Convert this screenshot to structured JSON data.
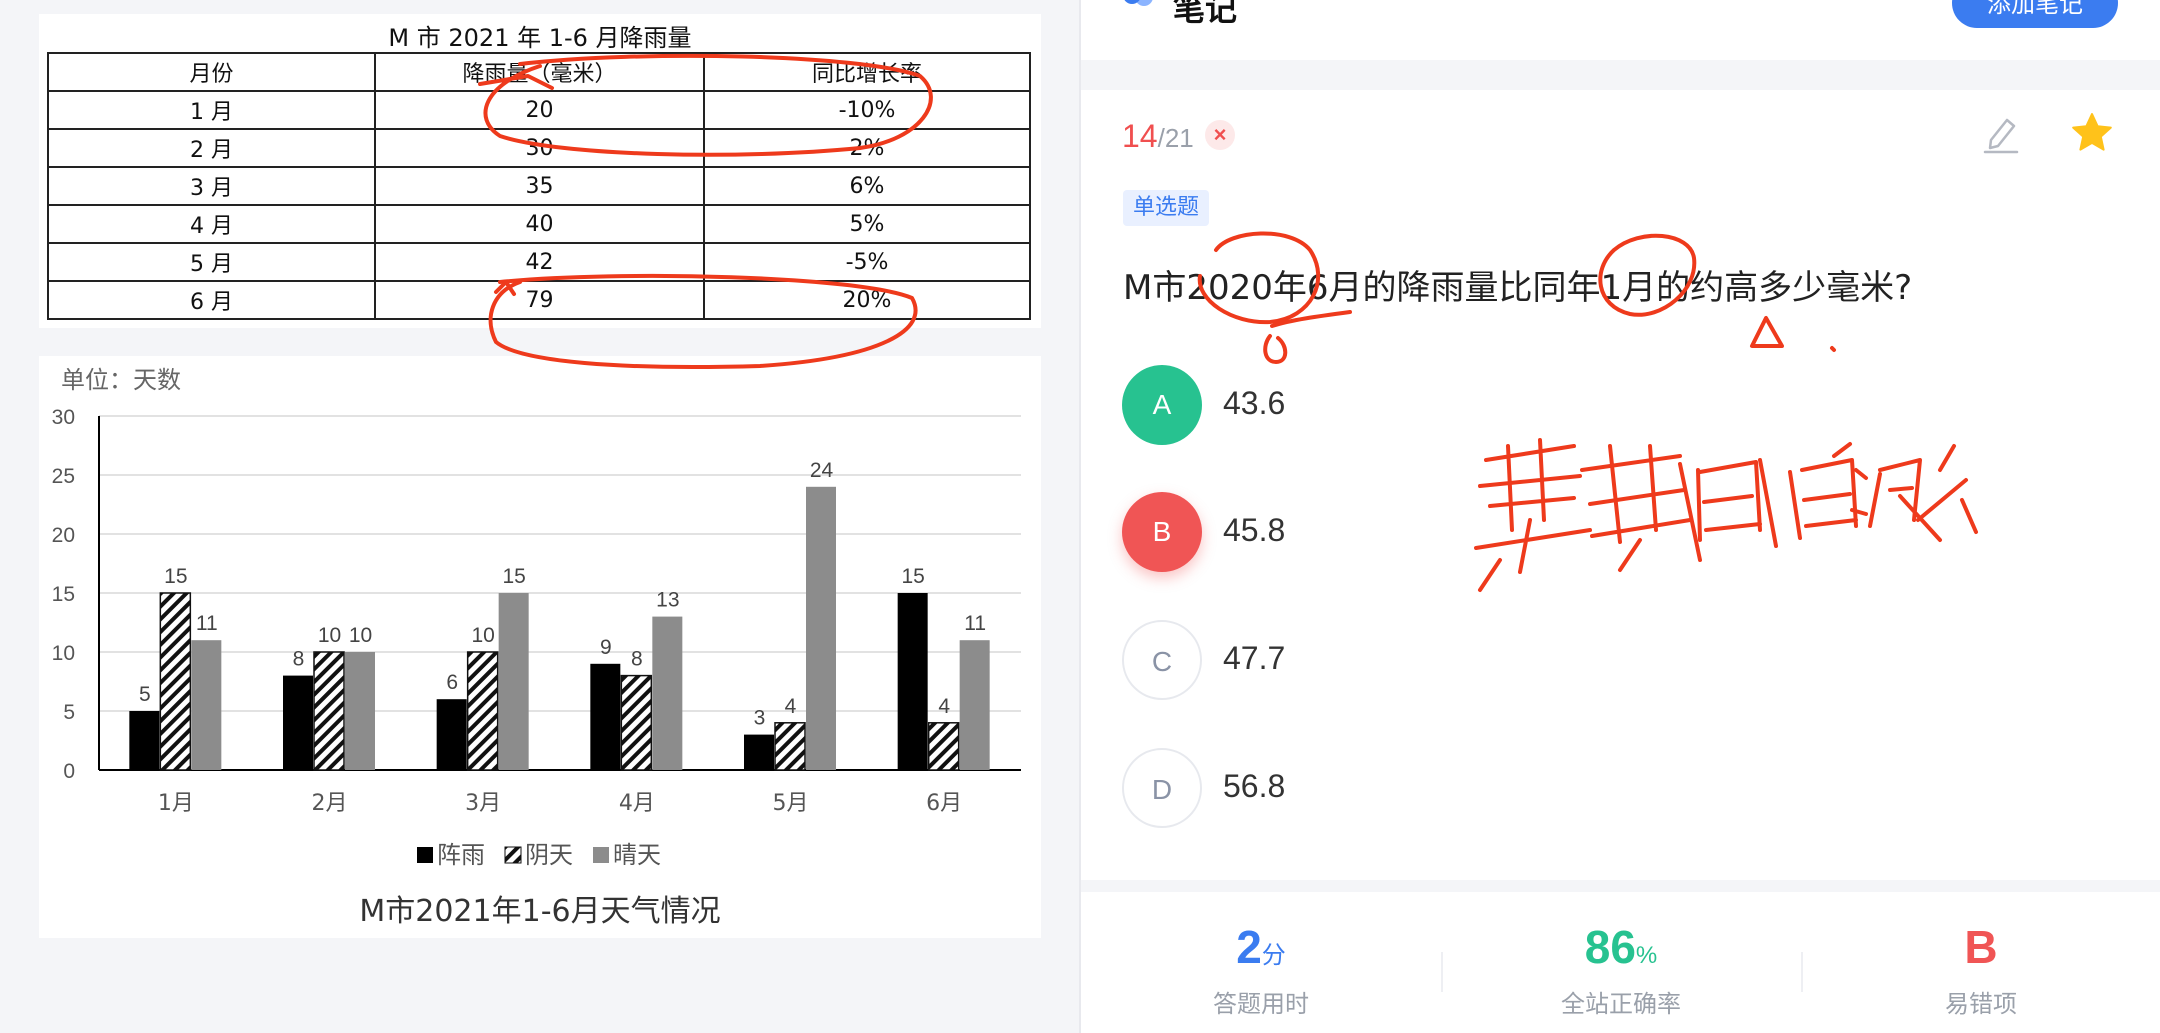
{
  "table": {
    "title": "M 市 2021 年 1-6 月降雨量",
    "headers": [
      "月份",
      "降雨量（毫米）",
      "同比增长率"
    ],
    "rows": [
      [
        "1 月",
        "20",
        "-10%"
      ],
      [
        "2 月",
        "30",
        "2%"
      ],
      [
        "3 月",
        "35",
        "6%"
      ],
      [
        "4 月",
        "40",
        "5%"
      ],
      [
        "5 月",
        "42",
        "-5%"
      ],
      [
        "6 月",
        "79",
        "20%"
      ]
    ]
  },
  "chart_data": {
    "type": "bar",
    "title": "M市2021年1-6月天气情况",
    "unit_label": "单位：天数",
    "categories": [
      "1月",
      "2月",
      "3月",
      "4月",
      "5月",
      "6月"
    ],
    "series": [
      {
        "name": "阵雨",
        "values": [
          5,
          8,
          6,
          9,
          3,
          15
        ],
        "color": "#000000",
        "pattern": "solid"
      },
      {
        "name": "阴天",
        "values": [
          15,
          10,
          10,
          8,
          4,
          4
        ],
        "color": "#000000",
        "pattern": "hatched"
      },
      {
        "name": "晴天",
        "values": [
          11,
          10,
          15,
          13,
          24,
          11
        ],
        "color": "#8c8c8c",
        "pattern": "solid"
      }
    ],
    "yticks": [
      "0",
      "5",
      "10",
      "15",
      "20",
      "25",
      "30"
    ],
    "ylim": [
      0,
      30
    ],
    "grid": true,
    "legend_position": "bottom"
  },
  "header": {
    "title": "笔记",
    "add_note_label": "添加笔记"
  },
  "question": {
    "index": "14",
    "total": "/21",
    "wrong_mark": "×",
    "type": "单选题",
    "stem": "M市2020年6月的降雨量比同年1月的约高多少毫米?",
    "options": [
      {
        "letter": "A",
        "text": "43.6"
      },
      {
        "letter": "B",
        "text": "45.8"
      },
      {
        "letter": "C",
        "text": "47.7"
      },
      {
        "letter": "D",
        "text": "56.8"
      }
    ]
  },
  "stats": {
    "time_value": "2",
    "time_unit": "分",
    "time_label": "答题用时",
    "accuracy_value": "86",
    "accuracy_unit": "%",
    "accuracy_label": "全站正确率",
    "wrong_value": "B",
    "wrong_label": "易错项"
  },
  "colors": {
    "accent": "#3b7cf0",
    "correct": "#27c290",
    "wrong": "#f05555",
    "annotation": "#ee3a1c"
  },
  "icons": [
    "edit-icon",
    "star-icon",
    "close-icon",
    "note-icon"
  ]
}
